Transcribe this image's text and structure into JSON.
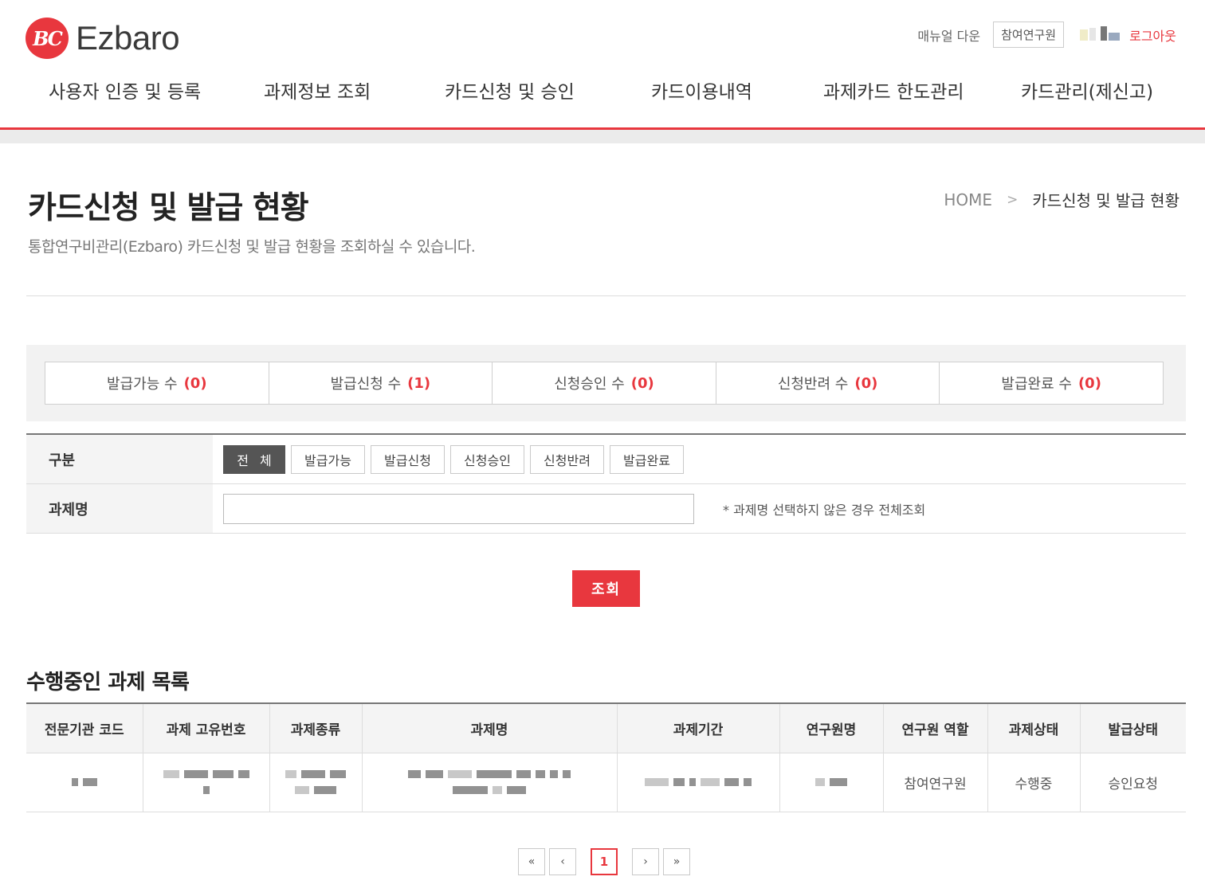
{
  "brand": {
    "mark": "BC",
    "name": "Ezbaro",
    "color": "#e8373e"
  },
  "util": {
    "manual": "매뉴얼 다운",
    "role": "참여연구원",
    "logout": "로그아웃"
  },
  "gnb": [
    "사용자 인증 및 등록",
    "과제정보 조회",
    "카드신청 및 승인",
    "카드이용내역",
    "과제카드 한도관리",
    "카드관리(제신고)"
  ],
  "page": {
    "title": "카드신청 및 발급 현황",
    "desc": "통합연구비관리(Ezbaro) 카드신청 및 발급 현황을 조회하실 수 있습니다.",
    "breadcrumb": {
      "home": "HOME",
      "current": "카드신청 및 발급 현황"
    }
  },
  "stats": [
    {
      "label": "발급가능 수",
      "count": "(0)"
    },
    {
      "label": "발급신청 수",
      "count": "(1)"
    },
    {
      "label": "신청승인 수",
      "count": "(0)"
    },
    {
      "label": "신청반려 수",
      "count": "(0)"
    },
    {
      "label": "발급완료 수",
      "count": "(0)"
    }
  ],
  "form": {
    "type_label": "구분",
    "type_buttons": [
      "전체",
      "발급가능",
      "발급신청",
      "신청승인",
      "신청반려",
      "발급완료"
    ],
    "name_label": "과제명",
    "name_value": "",
    "name_note": "* 과제명 선택하지 않은 경우 전체조회",
    "search": "조회"
  },
  "list": {
    "title": "수행중인 과제 목록",
    "columns": [
      "전문기관 코드",
      "과제 고유번호",
      "과제종류",
      "과제명",
      "과제기간",
      "연구원명",
      "연구원 역할",
      "과제상태",
      "발급상태"
    ],
    "rows": [
      {
        "role": "참여연구원",
        "status": "수행중",
        "issue": "승인요청"
      }
    ]
  },
  "pager": {
    "first": "«",
    "prev": "‹",
    "current": "1",
    "next": "›",
    "last": "»"
  }
}
